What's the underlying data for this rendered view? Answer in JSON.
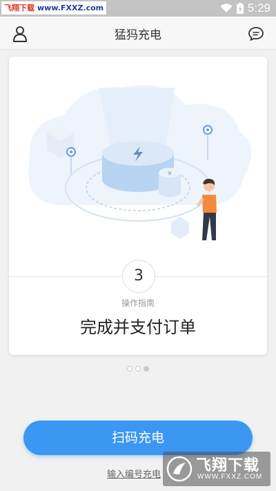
{
  "status_bar": {
    "watermark_site": "飞翔下载",
    "watermark_url": "www.FXXZ.com",
    "time": "5:29",
    "icons": [
      "wifi-icon",
      "battery-charging-icon"
    ]
  },
  "header": {
    "title": "猛犸充电",
    "left_icon": "user-profile-icon",
    "right_icon": "message-icon"
  },
  "guide_card": {
    "step_number": "3",
    "subtitle": "操作指南",
    "title": "完成并支付订单",
    "illustration": "charging-station-illustration"
  },
  "pagination": {
    "total": 3,
    "active_index": 2
  },
  "actions": {
    "scan_label": "扫码充电",
    "code_label": "输入编号充电"
  },
  "watermark": {
    "name": "飞翔下载",
    "url": "WWW.FXXZ.COM"
  },
  "colors": {
    "primary": "#3b97f2",
    "background": "#f1f1f1",
    "status_bar": "#c3c3c3"
  }
}
